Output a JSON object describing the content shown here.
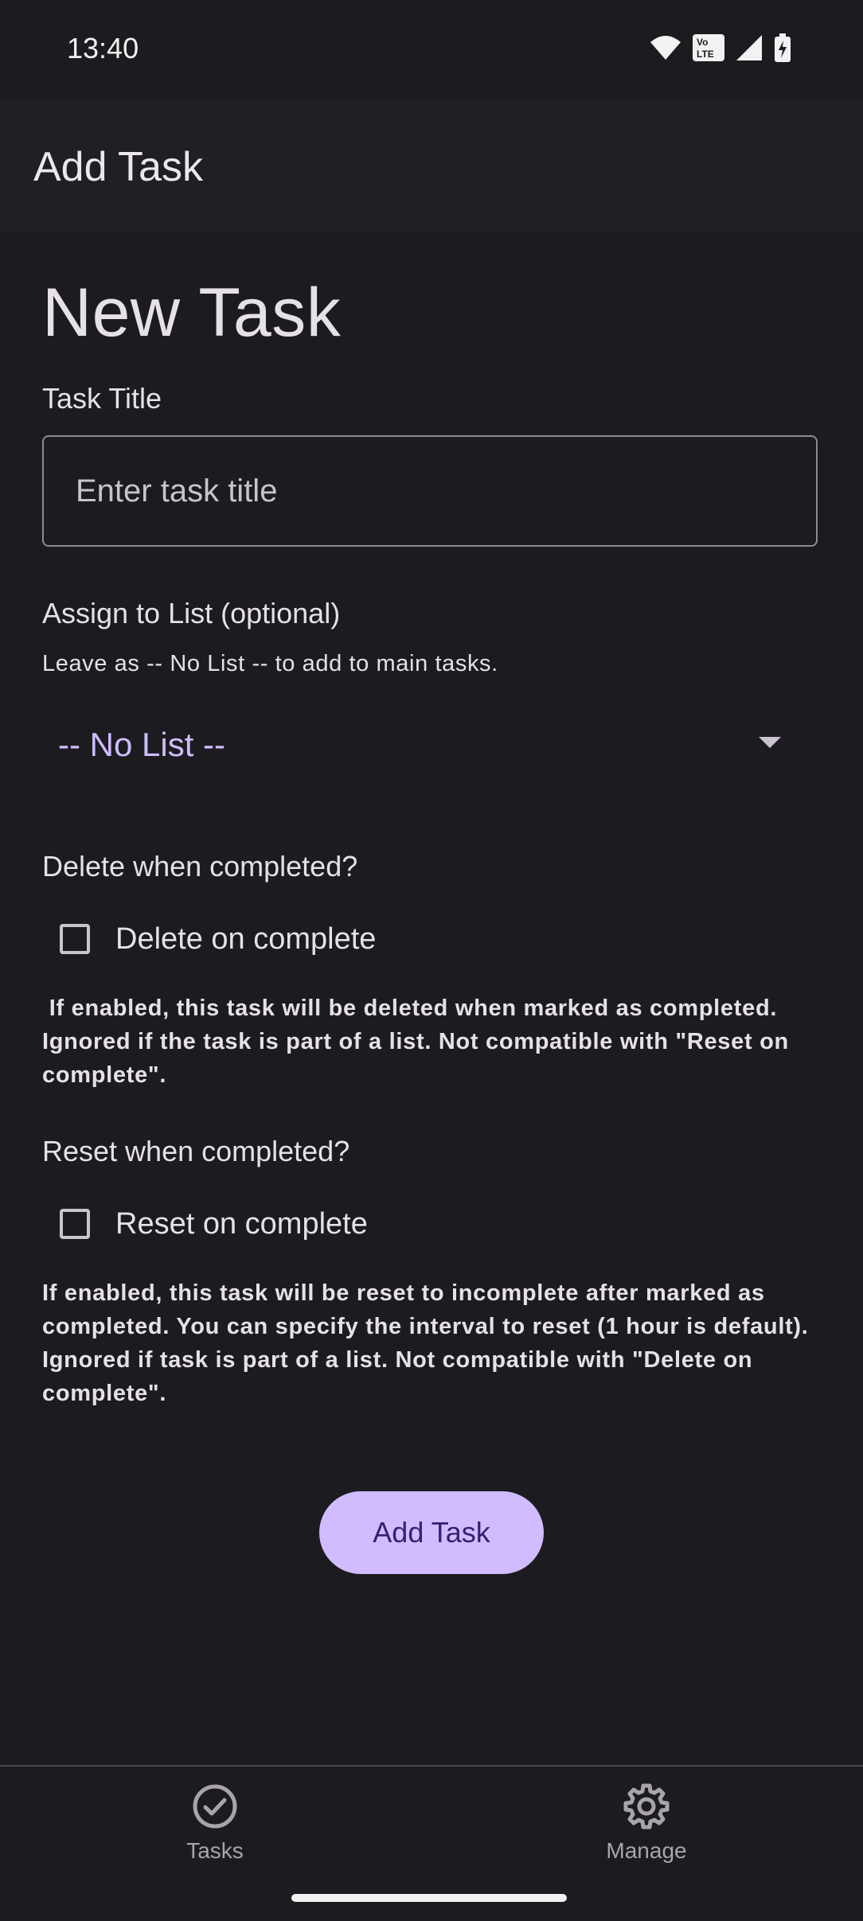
{
  "status_bar": {
    "time": "13:40",
    "icons": [
      "wifi-icon",
      "volte-icon",
      "signal-icon",
      "battery-charging-icon"
    ],
    "volte_text": "Vo LTE"
  },
  "app_bar": {
    "title": "Add Task"
  },
  "form": {
    "heading": "New Task",
    "title_label": "Task Title",
    "title_placeholder": "Enter task title",
    "title_value": "",
    "list_label": "Assign to List (optional)",
    "list_helper": "Leave as -- No List -- to add to main tasks.",
    "list_selected": "-- No List --",
    "delete_label": "Delete when completed?",
    "delete_checkbox_label": "Delete on complete",
    "delete_checked": false,
    "delete_note": " If enabled, this task will be deleted when marked as completed.\nIgnored if the task is part of a list. Not compatible with \"Reset on\ncomplete\".",
    "reset_label": "Reset when completed?",
    "reset_checkbox_label": "Reset on complete",
    "reset_checked": false,
    "reset_note": "If enabled, this task will be reset to incomplete after marked as\ncompleted. You can specify the interval to reset (1 hour is default).\nIgnored if task is part of a list. Not compatible with \"Delete on\ncomplete\".",
    "submit_label": "Add Task"
  },
  "bottom_nav": {
    "items": [
      {
        "label": "Tasks",
        "icon": "check-circle-icon"
      },
      {
        "label": "Manage",
        "icon": "gear-icon"
      }
    ]
  },
  "colors": {
    "background": "#1c1b1f",
    "accent": "#d0bcff",
    "accent_text": "#cfbcff"
  }
}
